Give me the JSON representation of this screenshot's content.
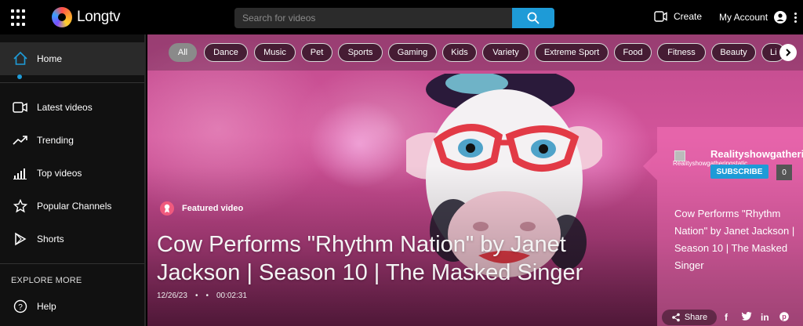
{
  "app": {
    "name": "Longtv"
  },
  "search": {
    "placeholder": "Search for videos"
  },
  "header": {
    "create_label": "Create",
    "account_label": "My Account"
  },
  "sidebar": {
    "items": [
      {
        "label": "Home",
        "icon": "home-icon",
        "active": true
      },
      {
        "label": "Latest videos",
        "icon": "video-camera-icon"
      },
      {
        "label": "Trending",
        "icon": "trending-icon"
      },
      {
        "label": "Top videos",
        "icon": "bar-chart-icon"
      },
      {
        "label": "Popular Channels",
        "icon": "star-icon"
      },
      {
        "label": "Shorts",
        "icon": "play-icon"
      }
    ],
    "explore_heading": "EXPLORE MORE",
    "help_label": "Help"
  },
  "categories": [
    {
      "label": "All",
      "active": true
    },
    {
      "label": "Dance"
    },
    {
      "label": "Music"
    },
    {
      "label": "Pet"
    },
    {
      "label": "Sports"
    },
    {
      "label": "Gaming"
    },
    {
      "label": "Kids"
    },
    {
      "label": "Variety"
    },
    {
      "label": "Extreme Sport"
    },
    {
      "label": "Food"
    },
    {
      "label": "Fitness"
    },
    {
      "label": "Beauty"
    },
    {
      "label": "Li"
    }
  ],
  "featured": {
    "badge_label": "Featured video",
    "title": "Cow Performs \"Rhythm Nation\" by Janet Jackson | Season 10 | The Masked Singer",
    "date": "12/26/23",
    "duration": "00:02:31"
  },
  "channel_card": {
    "channel_name": "Realityshowgatheringstatic",
    "avatar_alt": "Realityshowgatheringstatic",
    "subscribe_label": "SUBSCRIBE",
    "subscriber_count": "0",
    "video_title": "Cow Performs \"Rhythm Nation\" by Janet Jackson | Season 10 | The Masked Singer",
    "share_label": "Share",
    "social": [
      "f",
      "twitter",
      "in",
      "pinterest"
    ]
  },
  "colors": {
    "accent": "#1e9bd7",
    "sidebar_bg": "#111111",
    "active_chip": "#8a8a8a"
  }
}
